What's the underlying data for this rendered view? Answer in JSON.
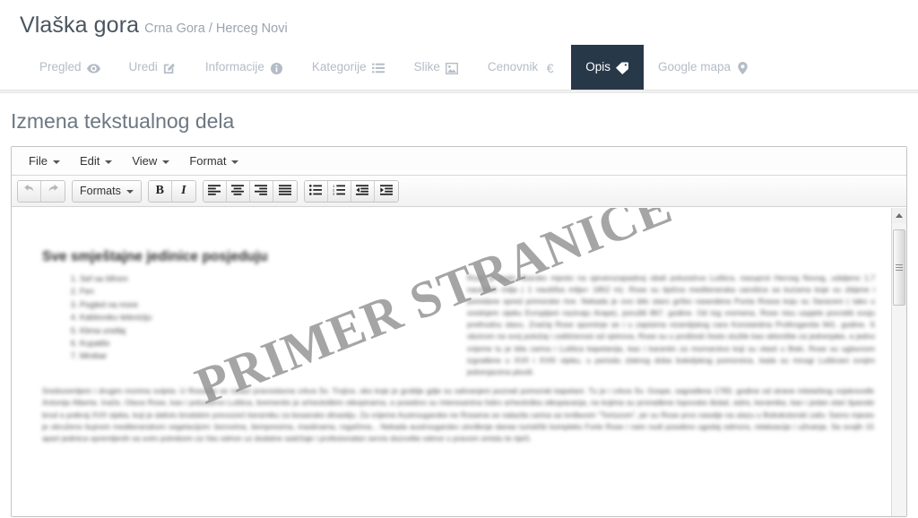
{
  "header": {
    "title": "Vlaška gora",
    "subtitle": "Crna Gora / Herceg Novi"
  },
  "nav": {
    "tabs": [
      {
        "label": "Pregled",
        "icon": "eye-icon",
        "active": false
      },
      {
        "label": "Uredi",
        "icon": "pencil-square-icon",
        "active": false
      },
      {
        "label": "Informacije",
        "icon": "info-circle-icon",
        "active": false
      },
      {
        "label": "Kategorije",
        "icon": "list-icon",
        "active": false
      },
      {
        "label": "Slike",
        "icon": "image-icon",
        "active": false
      },
      {
        "label": "Cenovnik",
        "icon": "euro-icon",
        "active": false
      },
      {
        "label": "Opis",
        "icon": "tag-icon",
        "active": true
      },
      {
        "label": "Google mapa",
        "icon": "map-marker-icon",
        "active": false
      }
    ],
    "active_background": "#273849",
    "inactive_color": "#b4bcc6"
  },
  "section": {
    "title": "Izmena tekstualnog dela"
  },
  "editor": {
    "menubar": [
      {
        "label": "File"
      },
      {
        "label": "Edit"
      },
      {
        "label": "View"
      },
      {
        "label": "Format"
      }
    ],
    "toolbar": {
      "undo": "undo-icon",
      "redo": "redo-icon",
      "formats_label": "Formats",
      "bold": "B",
      "italic": "I",
      "align_left": "align-left-icon",
      "align_center": "align-center-icon",
      "align_right": "align-right-icon",
      "align_justify": "align-justify-icon",
      "bullist": "bullet-list-icon",
      "numlist": "numbered-list-icon",
      "outdent": "outdent-icon",
      "indent": "indent-icon"
    },
    "watermark": "PRIMER STRANICE",
    "content": {
      "heading": "Sve smještajne jedinice posjeduju",
      "list": [
        "Sef sa šifrom",
        "Fen",
        "Pogled na more",
        "Kablovsku televiziju",
        "Klima uređaj",
        "Kupatilo",
        "Minibar"
      ],
      "right_paragraph": "Rose je malo ribarsko mjesto na sjeverozapadnoj obali poluostrva Luštica, nasuprot Herceg Novog, udaljeno 1,7 nautičkih milja ( 1 nautička milja= 1852 m). Rose su tipična mediteranska varošica sa kućama koje su zbijene i poredane spred primorske rive. Nekada je ovo bilo staro grčko naseobina Punta Rossa koju su Saraceni ( tako u srednjem vijeku Evropljani nazivaju Arape), porušili 867. godine. Od tog vremena, Rose nisu uspjele povratiti svoju prethodnu slavu. Značaj Rose spominje se i u zapisima vizantijskog cara Konstantina Profirogenita 941. godine. S obzirom na svoj položaj i zaštićenost od vjetrova, Rose su u prošlosti često služile kao sklonište za jedrenjake, a jedno vrijeme tu je bila carina i Luštica kapetanija, kao i karantin za mornarstvo koji su vlasti u Boki, Rose su uglavnom izgrađene u XVII i XVIII vijeku, u periodu zlatnog doba bokeljskog pomorstva, kada su mnogi Lušticani svojim jedrenjacima plovili.",
      "bottom_paragraph": "Sredozemljem i drugim morima svijeta. U Rosama se nalazi pravoslavna crkva Sv. Trojice, oko koje je groblje gdje su sahranjeni poznati pomorski kapetani. Tu je i crkva Sv. Gospe, sagrađena 1783. godine od strane mletačkog vojskovođe Antonija Alberta. Inače, Otava Rose, kao i poluostrvo Luštica, bremenito je arheološkim otkopinama, a posebno su interesantna hidro arheološka otkopavanja, na kojima su pronađene topovske đulad, sidra, keramika, kao i jedan stari španski brod a potkraj XVII vijeka, koji je dalivio brodskim prevozeći keramiku za bosansko dinastiju. Za vrijeme Austrougarske ne Rosama se nalazila carina sa tvrđavom \"Tortozom\", jer su Rose prvo naselje na ulazu u Bokokotorski zaliv. Samo mjesto je okruženo bujnom mediteranskom vegetacijom: borovima, šempresima, maslinama, rogačima... Nekada austrougarsko utvrđenje danas turistički kompleks Forte Rose i nam nudi posebno ugodaj odmora, relaksacija i uživanja. Sa svojih 15 apart jedinica opremljenih sa svim potrebom za Vas odmor uz dodatne sadržaje i profesionalan servis dozvolite odmor u pravom smislu te riječi.",
      "page_border_style": "dashed"
    },
    "scrollbar": {
      "up_arrow": "triangle-up-icon",
      "thumb_grip": "grip-lines-icon"
    }
  }
}
